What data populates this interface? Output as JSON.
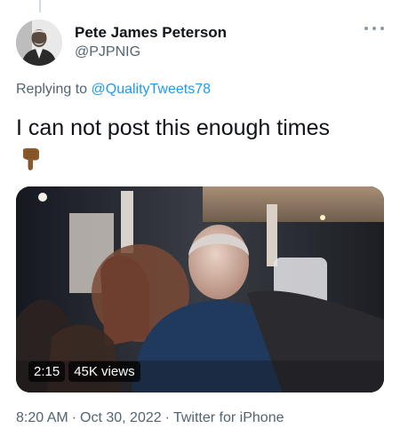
{
  "tweet": {
    "author": {
      "display_name": "Pete James Peterson",
      "handle": "@PJPNIG",
      "avatar_icon": "profile-photo"
    },
    "more_icon": "ellipsis-icon",
    "reply": {
      "prefix": "Replying to ",
      "mention": "@QualityTweets78"
    },
    "text": "I can not post this enough times",
    "emoji": "backhand-index-pointing-down",
    "media": {
      "duration": "2:15",
      "views": "45K views"
    },
    "meta": {
      "time": "8:20 AM",
      "date": "Oct 30, 2022",
      "source": "Twitter for iPhone",
      "separator": "·"
    }
  },
  "colors": {
    "text_primary": "#0f1419",
    "text_secondary": "#536471",
    "link": "#1d9bf0"
  }
}
